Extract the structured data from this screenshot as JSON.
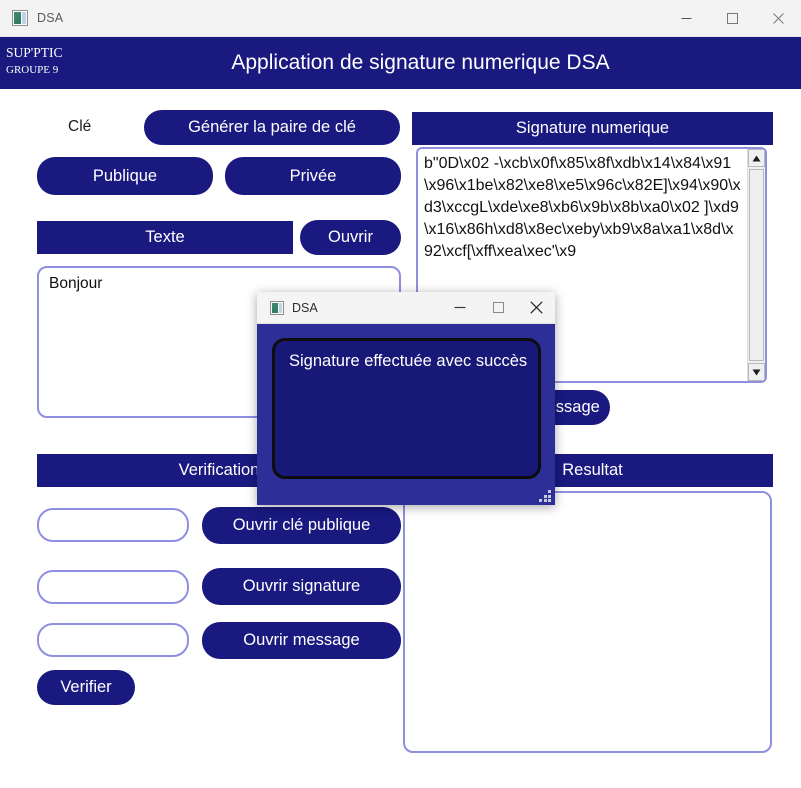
{
  "window": {
    "title": "DSA",
    "icon": "app-icon",
    "controls": [
      {
        "name": "minimize",
        "glyph": "minimize-icon"
      },
      {
        "name": "maximize",
        "glyph": "maximize-icon"
      },
      {
        "name": "close",
        "glyph": "close-icon"
      }
    ]
  },
  "header": {
    "brand_line1": "SUP'PTIC",
    "brand_line2": "GROUPE 9",
    "app_title": "Application de signature numerique DSA",
    "background": "#191980"
  },
  "key_section": {
    "cle_label": "Clé",
    "generate_pair_button": "Générer la paire de clé",
    "public_button": "Publique",
    "private_button": "Privée"
  },
  "text_section": {
    "texte_bar": "Texte",
    "open_button": "Ouvrir",
    "textarea_value": "Bonjour"
  },
  "signature_section": {
    "header_bar": "Signature numerique",
    "signature_value": "b\"0D\\x02 -\\xcb\\x0f\\x85\\x8f\\xdb\\x14\\x84\\x91\\x96\\x1be\\x82\\xe8\\xe5\\x96c\\x82E]\\x94\\x90\\xd3\\xccgL\\xde\\xe8\\xb6\\x9b\\x8b\\xa0\\x02 ]\\xd9\\x16\\x86h\\xd8\\x8ec\\xeby\\xb9\\x8a\\xa1\\x8d\\x92\\xcf[\\xff\\xea\\xec'\\x9",
    "sign_button": "Signer le message",
    "scrollbar": {
      "up_arrow": "scroll-up-icon",
      "down_arrow": "scroll-down-icon"
    }
  },
  "verification_section": {
    "header_bar": "Verification",
    "rows": [
      {
        "field_value": "",
        "button": "Ouvrir clé publique"
      },
      {
        "field_value": "",
        "button": "Ouvrir signature"
      },
      {
        "field_value": "",
        "button": "Ouvrir message"
      }
    ],
    "verify_button": "Verifier"
  },
  "result_section": {
    "header_bar": "Resultat",
    "result_value": ""
  },
  "dialog": {
    "title": "DSA",
    "message": "Signature effectuée avec succès",
    "controls": [
      {
        "name": "minimize",
        "glyph": "minimize-icon"
      },
      {
        "name": "maximize",
        "glyph": "maximize-icon"
      },
      {
        "name": "close",
        "glyph": "close-icon"
      }
    ],
    "background": "#2e2e99",
    "message_background": "#181878"
  },
  "colors": {
    "navy": "#191980",
    "dialog_blue": "#2e2e99",
    "field_border": "#8f8fe0",
    "white": "#ffffff"
  }
}
